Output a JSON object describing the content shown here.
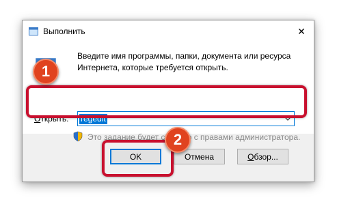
{
  "window": {
    "title": "Выполнить",
    "close_symbol": "✕"
  },
  "content": {
    "description": "Введите имя программы, папки, документа или ресурса Интернета, которые требуется открыть.",
    "open_label_prefix": "",
    "open_label_underlined": "О",
    "open_label_rest": "ткрыть:",
    "input_value": "regedit",
    "admin_note": "Это задание будет создано с правами администратора."
  },
  "buttons": {
    "ok": "OK",
    "cancel": "Отмена",
    "browse_underlined": "О",
    "browse_rest": "бзор..."
  },
  "annotations": {
    "badge_1": "1",
    "badge_2": "2"
  },
  "colors": {
    "accent": "#0078d7",
    "highlight": "#c8102e",
    "badge": "#e0431f"
  }
}
